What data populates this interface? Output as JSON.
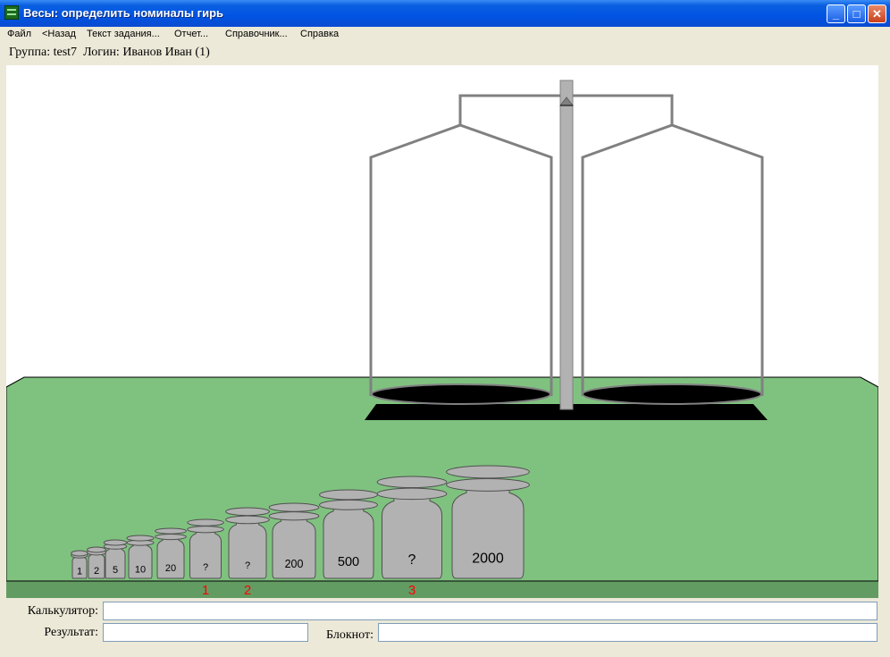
{
  "window": {
    "title": "Весы: определить номиналы гирь"
  },
  "window_controls": {
    "minimize": "_",
    "maximize": "□",
    "close": "✕"
  },
  "menu": [
    "Файл",
    "<Назад",
    "Текст задания...",
    "Отчет...",
    "Справочник...",
    "Справка"
  ],
  "info": {
    "group_text": "Группа: test7",
    "login_text": "Логин: Иванов Иван (1)"
  },
  "weights": [
    {
      "label": "1"
    },
    {
      "label": "2"
    },
    {
      "label": "5"
    },
    {
      "label": "10"
    },
    {
      "label": "20"
    },
    {
      "label": "?",
      "marker": "1"
    },
    {
      "label": "?",
      "marker": "2"
    },
    {
      "label": "200"
    },
    {
      "label": "500"
    },
    {
      "label": "?",
      "marker": "3"
    },
    {
      "label": "2000"
    }
  ],
  "colors": {
    "table": "#7fc27f",
    "weight_fill": "#b2b2b2",
    "marker": "#ff0000",
    "pan": "#000000"
  },
  "fields": {
    "calculator_label": "Калькулятор:",
    "calculator_value": "",
    "result_label": "Результат:",
    "result_value": "",
    "notepad_label": "Блокнот:",
    "notepad_value": ""
  }
}
